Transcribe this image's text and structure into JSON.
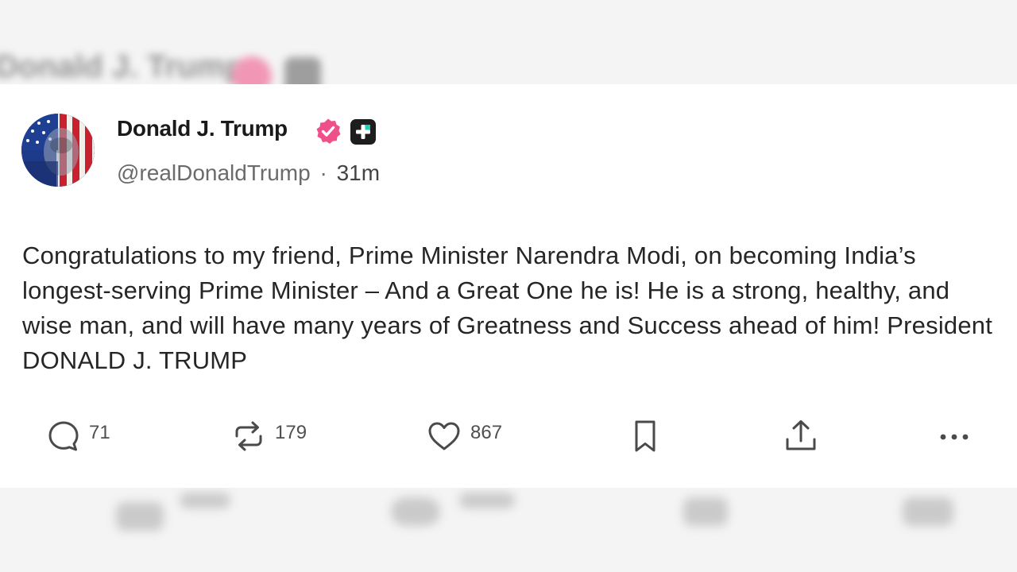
{
  "post": {
    "author_name": "Donald J. Trump",
    "handle": "@realDonaldTrump",
    "separator": "·",
    "time_ago": "31m",
    "body": "Congratulations to my friend, Prime Minister Narendra Modi, on becoming India’s longest-serving Prime Minister – And a Great One he is! He is a strong, healthy, and wise man, and will have many years of Greatness and Success ahead of him! President DONALD J. TRUMP"
  },
  "actions": {
    "replies": "71",
    "reposts": "179",
    "likes": "867"
  },
  "background": {
    "blurred_name": "Donald J. Trump"
  },
  "colors": {
    "verified_badge": "#f0508a",
    "plus_badge": "#1d1d1d",
    "icon": "#4a4a4a"
  }
}
